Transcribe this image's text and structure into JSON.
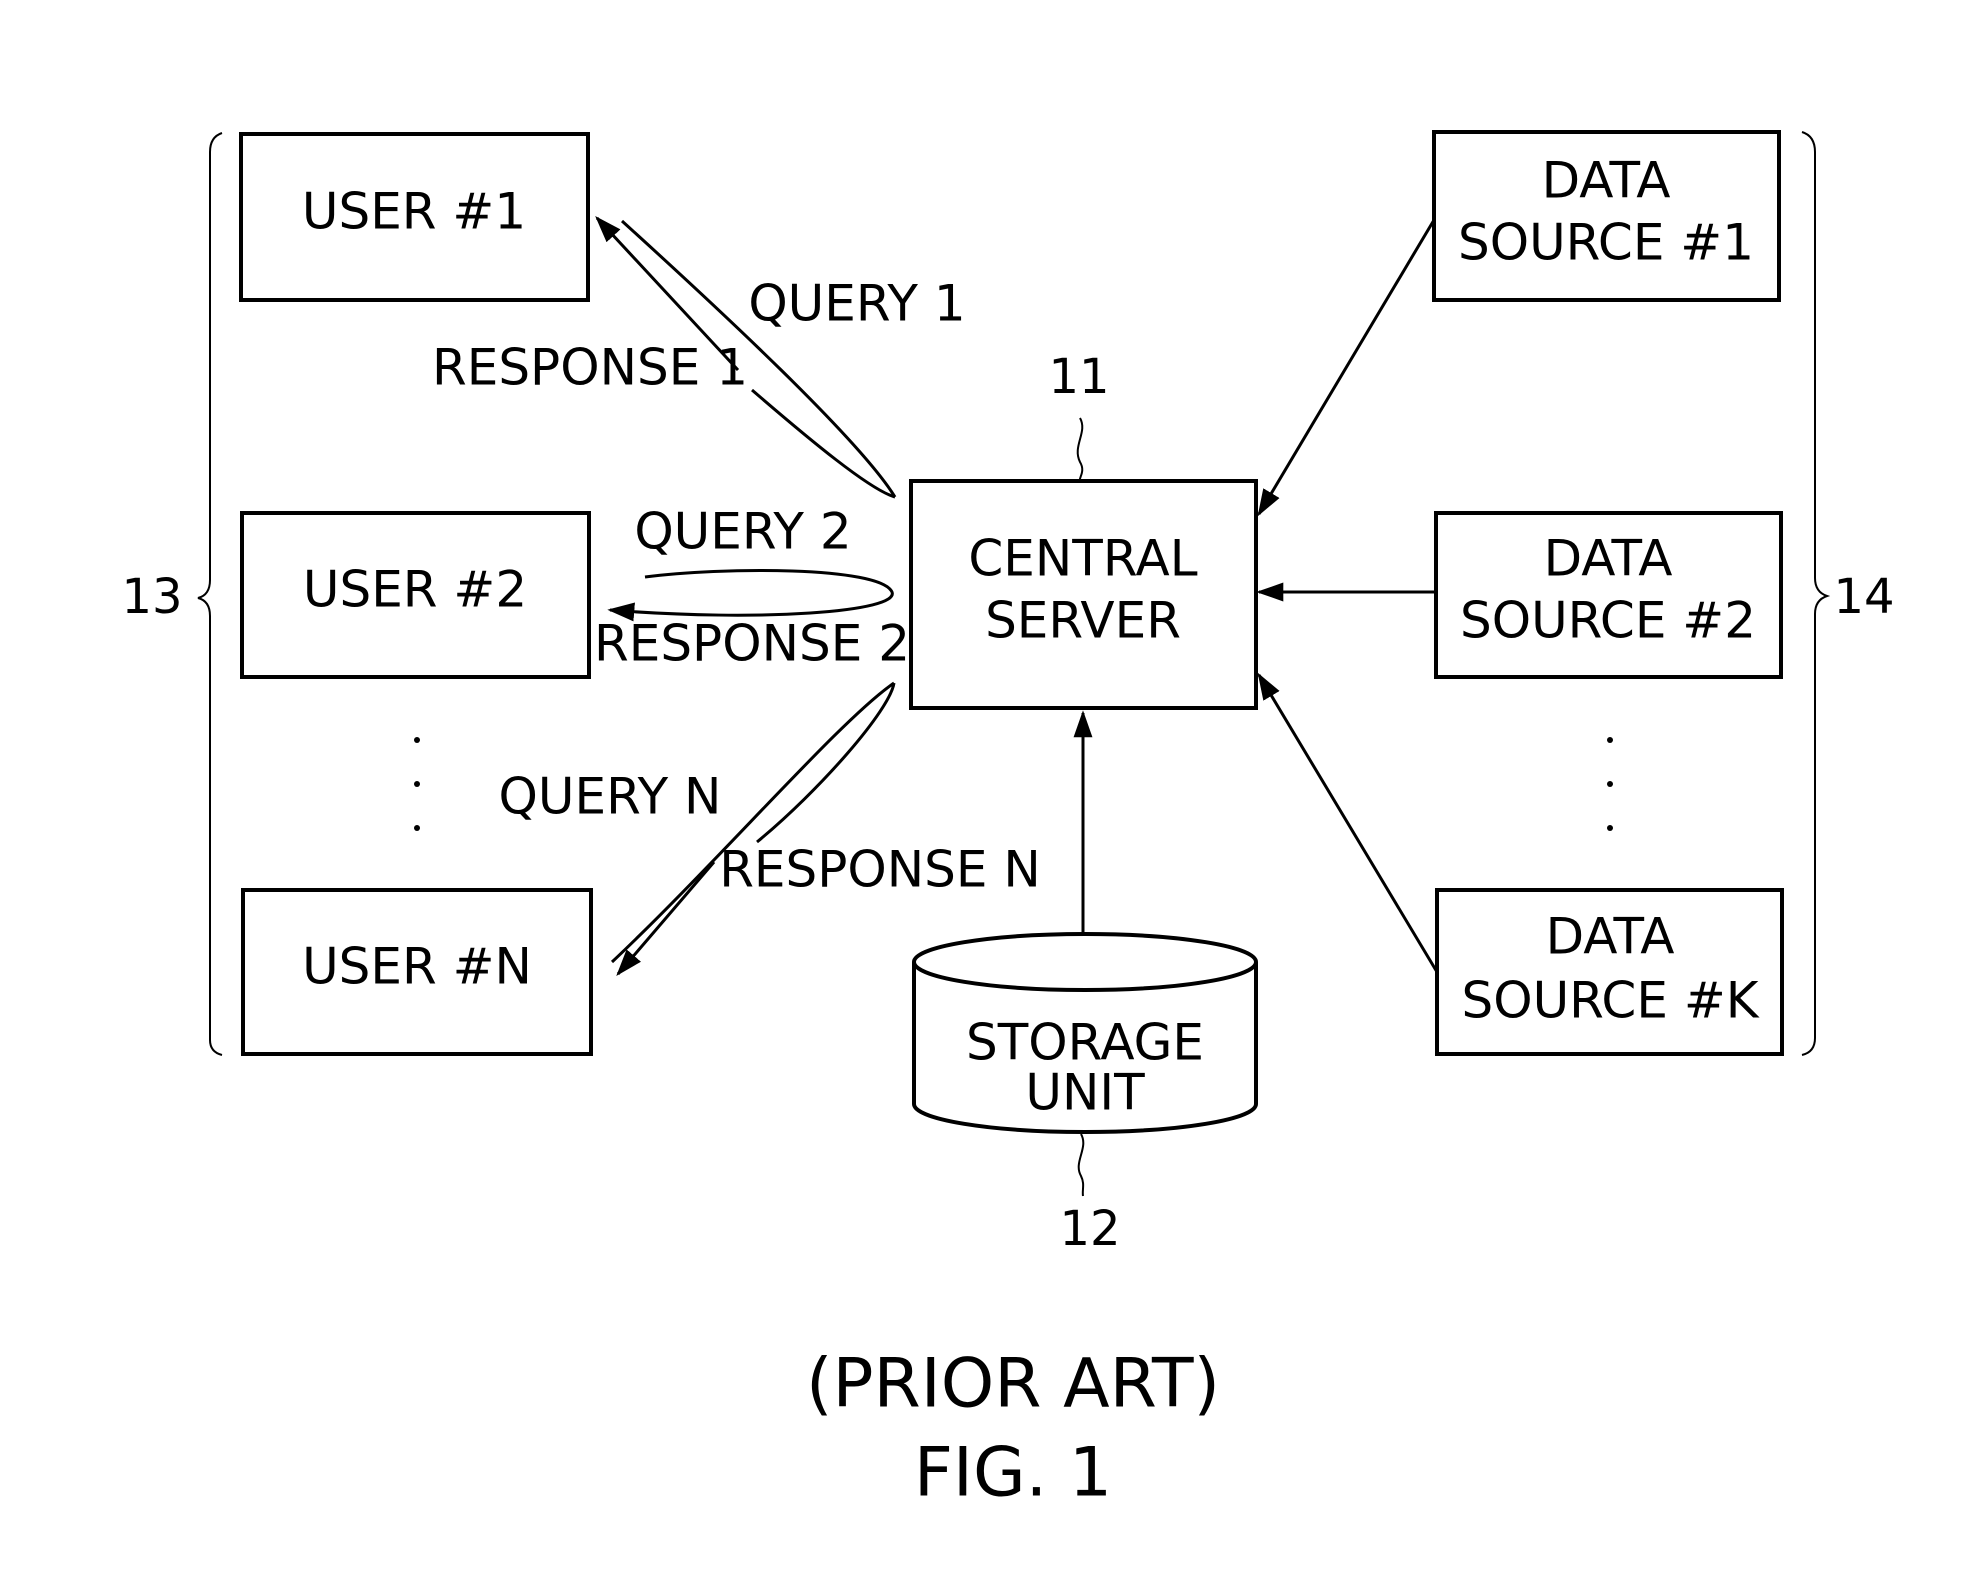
{
  "figure": {
    "prior_art_label": "(PRIOR ART)",
    "fig_label": "FIG. 1"
  },
  "users": {
    "ref_number": "13",
    "items": [
      {
        "label": "USER #1"
      },
      {
        "label": "USER #2"
      },
      {
        "label": "USER #N"
      }
    ]
  },
  "central_server": {
    "ref_number": "11",
    "label_line1": "CENTRAL",
    "label_line2": "SERVER"
  },
  "storage_unit": {
    "ref_number": "12",
    "label_line1": "STORAGE",
    "label_line2": "UNIT"
  },
  "data_sources": {
    "ref_number": "14",
    "items": [
      {
        "line1": "DATA",
        "line2": "SOURCE #1"
      },
      {
        "line1": "DATA",
        "line2": "SOURCE #2"
      },
      {
        "line1": "DATA",
        "line2": "SOURCE #K"
      }
    ]
  },
  "flows": {
    "query_1": "QUERY 1",
    "response_1": "RESPONSE 1",
    "query_2": "QUERY 2",
    "response_2": "RESPONSE 2",
    "query_n": "QUERY N",
    "response_n": "RESPONSE N"
  }
}
